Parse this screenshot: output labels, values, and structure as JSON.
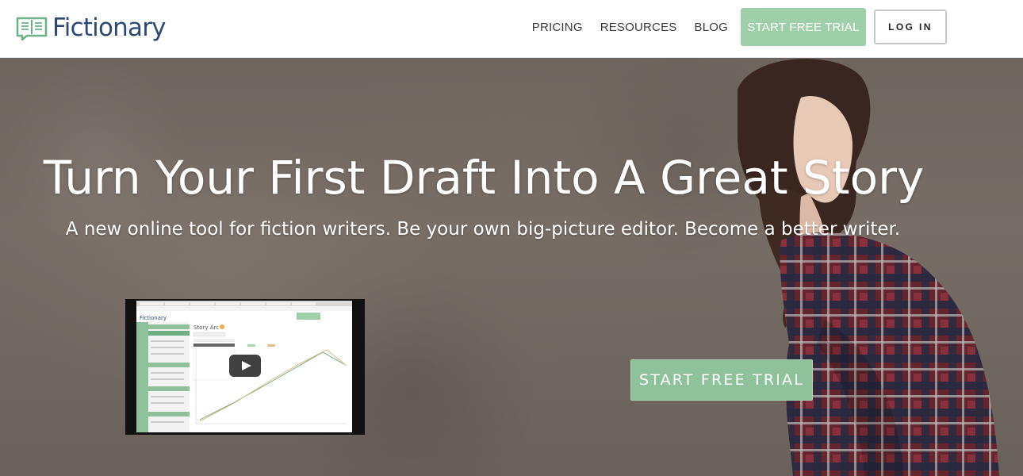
{
  "header": {
    "logo_text": "Fictionary",
    "logo_icon": "book-chat-icon",
    "nav": [
      "PRICING",
      "RESOURCES",
      "BLOG"
    ],
    "trial_label": "START FREE TRIAL",
    "login_label": "LOG IN"
  },
  "hero": {
    "title": "Turn Your First Draft Into A Great Story",
    "subtitle": "A new online tool for fiction writers. Be your own big-picture editor. Become a better writer.",
    "cta_label": "START FREE TRIAL"
  },
  "video": {
    "play_icon": "play-icon",
    "app_logo": "Fictionary",
    "panel_title": "Story Arc"
  },
  "colors": {
    "brand": "#2e4a73",
    "accent": "#9fcfa9",
    "cta": "#8fc19b"
  }
}
